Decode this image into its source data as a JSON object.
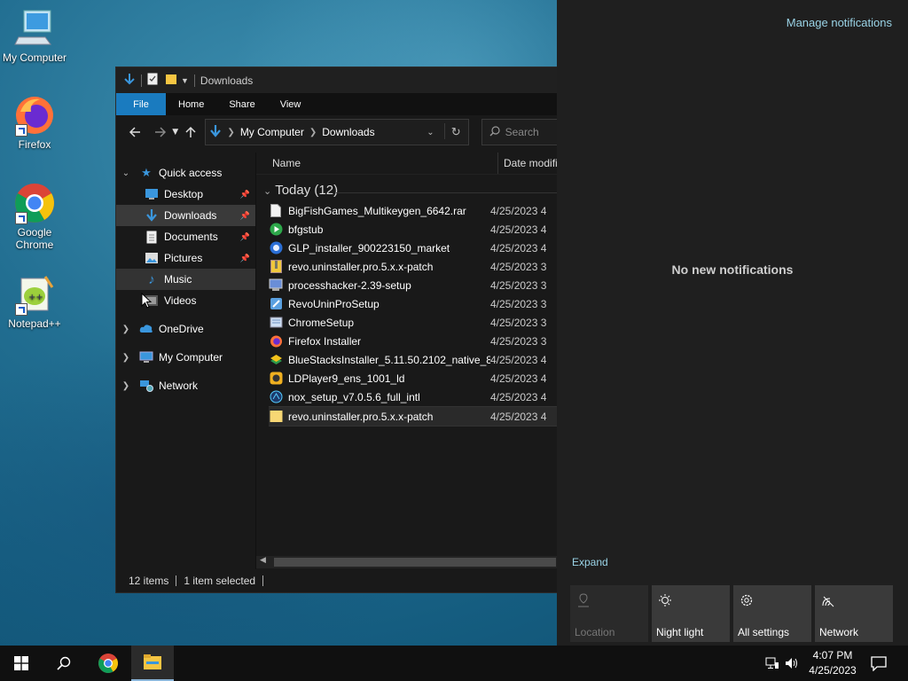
{
  "desktop": {
    "icons": [
      {
        "label": "My Computer",
        "icon": "computer-icon"
      },
      {
        "label": "Firefox",
        "icon": "firefox-icon"
      },
      {
        "label": "Google Chrome",
        "icon": "chrome-icon"
      },
      {
        "label": "Notepad++",
        "icon": "notepad-plus-plus-icon"
      }
    ]
  },
  "explorer": {
    "title": "Downloads",
    "ribbon_tabs": [
      "File",
      "Home",
      "Share",
      "View"
    ],
    "address": {
      "root": "My Computer",
      "current": "Downloads"
    },
    "search_placeholder": "Search",
    "nav": {
      "quick_access": "Quick access",
      "items": [
        "Desktop",
        "Downloads",
        "Documents",
        "Pictures",
        "Music",
        "Videos"
      ],
      "onedrive": "OneDrive",
      "my_computer": "My Computer",
      "network": "Network"
    },
    "columns": {
      "name": "Name",
      "date": "Date modified"
    },
    "group_label": "Today (12)",
    "files": [
      {
        "name": "BigFishGames_Multikeygen_6642.rar",
        "date": "4/25/2023 4",
        "icon": "file-icon"
      },
      {
        "name": "bfgstub",
        "date": "4/25/2023 4",
        "icon": "play-icon"
      },
      {
        "name": "GLP_installer_900223150_market",
        "date": "4/25/2023 4",
        "icon": "globe-icon"
      },
      {
        "name": "revo.uninstaller.pro.5.x.x-patch",
        "date": "4/25/2023 3",
        "icon": "zip-icon"
      },
      {
        "name": "processhacker-2.39-setup",
        "date": "4/25/2023 3",
        "icon": "setup-icon"
      },
      {
        "name": "RevoUninProSetup",
        "date": "4/25/2023 3",
        "icon": "revo-icon"
      },
      {
        "name": "ChromeSetup",
        "date": "4/25/2023 3",
        "icon": "chrome-setup-icon"
      },
      {
        "name": "Firefox Installer",
        "date": "4/25/2023 3",
        "icon": "firefox-installer-icon"
      },
      {
        "name": "BlueStacksInstaller_5.11.50.2102_native_8...",
        "date": "4/25/2023 4",
        "icon": "bluestacks-icon"
      },
      {
        "name": "LDPlayer9_ens_1001_ld",
        "date": "4/25/2023 4",
        "icon": "ldplayer-icon"
      },
      {
        "name": "nox_setup_v7.0.5.6_full_intl",
        "date": "4/25/2023 4",
        "icon": "nox-icon"
      },
      {
        "name": "revo.uninstaller.pro.5.x.x-patch",
        "date": "4/25/2023 4",
        "icon": "folder-icon"
      }
    ],
    "status": {
      "items": "12 items",
      "selected": "1 item selected"
    }
  },
  "action_center": {
    "manage": "Manage notifications",
    "empty": "No new notifications",
    "expand": "Expand",
    "quick_actions": [
      {
        "label": "Location",
        "icon": "location-icon",
        "enabled": false
      },
      {
        "label": "Night light",
        "icon": "night-light-icon",
        "enabled": true
      },
      {
        "label": "All settings",
        "icon": "gear-icon",
        "enabled": true
      },
      {
        "label": "Network",
        "icon": "network-icon",
        "enabled": true
      }
    ]
  },
  "taskbar": {
    "time": "4:07 PM",
    "date": "4/25/2023"
  },
  "colors": {
    "accent": "#1a7bbf",
    "link": "#9ad3e6"
  }
}
